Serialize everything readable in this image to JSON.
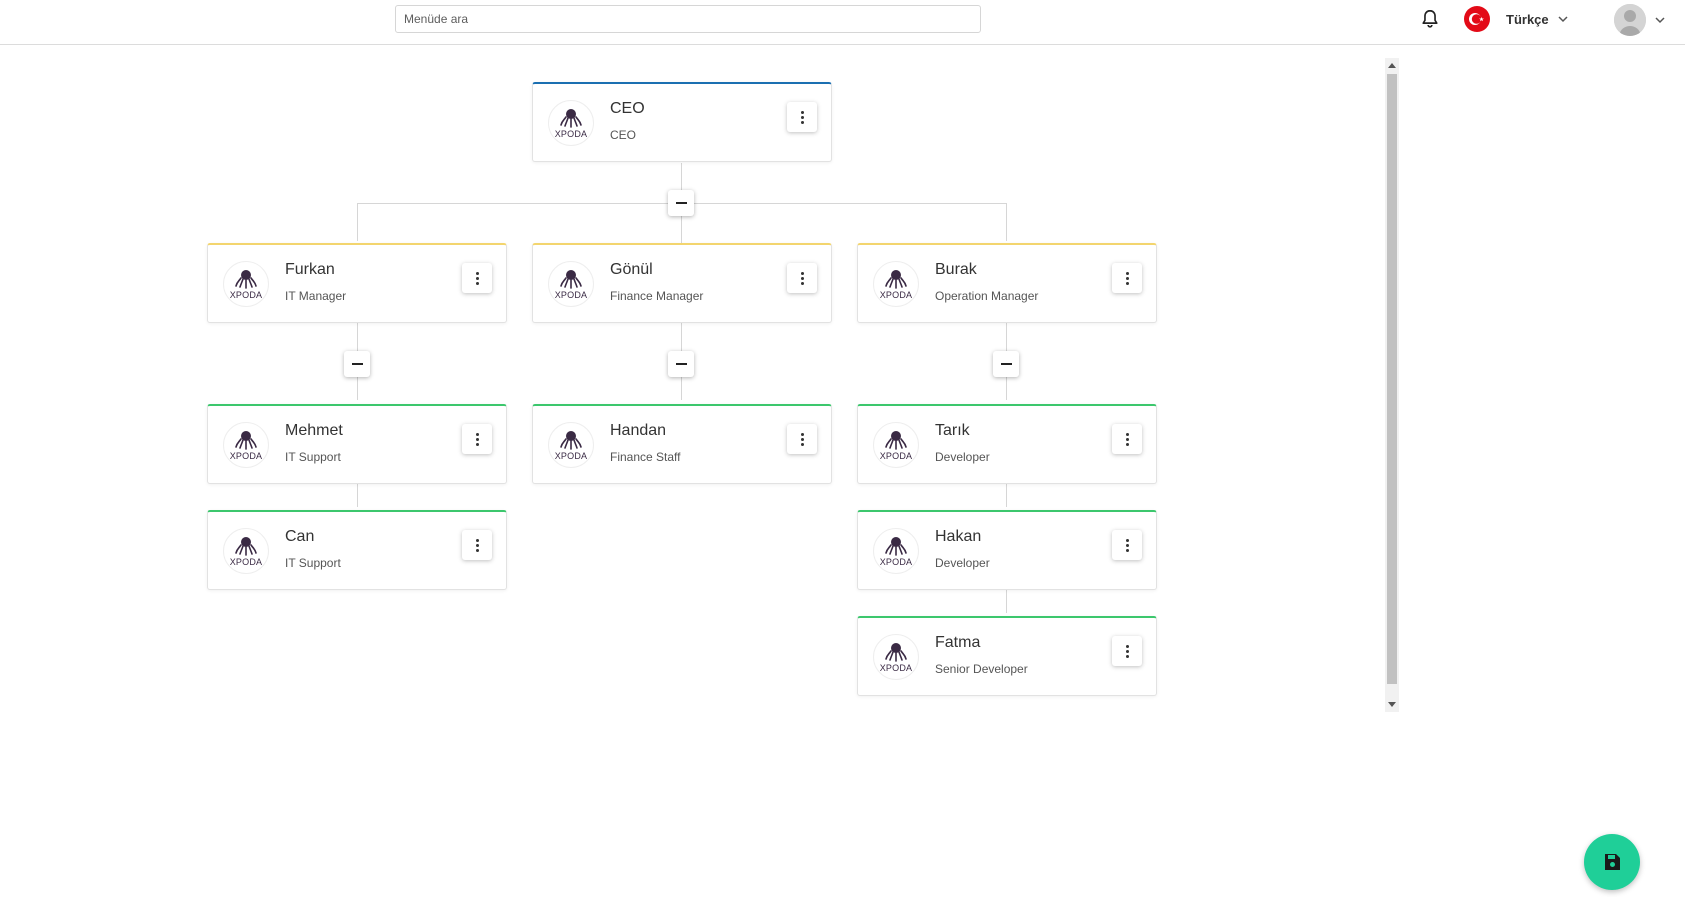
{
  "header": {
    "search_placeholder": "Menüde ara",
    "language": "Türkçe"
  },
  "org": {
    "logo_text": "XPODA",
    "nodes": [
      {
        "name": "CEO",
        "title": "CEO"
      },
      {
        "name": "Furkan",
        "title": "IT Manager"
      },
      {
        "name": "Gönül",
        "title": "Finance Manager"
      },
      {
        "name": "Burak",
        "title": "Operation Manager"
      },
      {
        "name": "Mehmet",
        "title": "IT Support"
      },
      {
        "name": "Can",
        "title": "IT Support"
      },
      {
        "name": "Handan",
        "title": "Finance Staff"
      },
      {
        "name": "Tarık",
        "title": "Developer"
      },
      {
        "name": "Hakan",
        "title": "Developer"
      },
      {
        "name": "Fatma",
        "title": "Senior Developer"
      }
    ]
  },
  "colors": {
    "root_accent": "#1b6fb1",
    "manager_accent": "#f3d56e",
    "staff_accent": "#3cc76d",
    "save_button": "#1fcf98"
  }
}
